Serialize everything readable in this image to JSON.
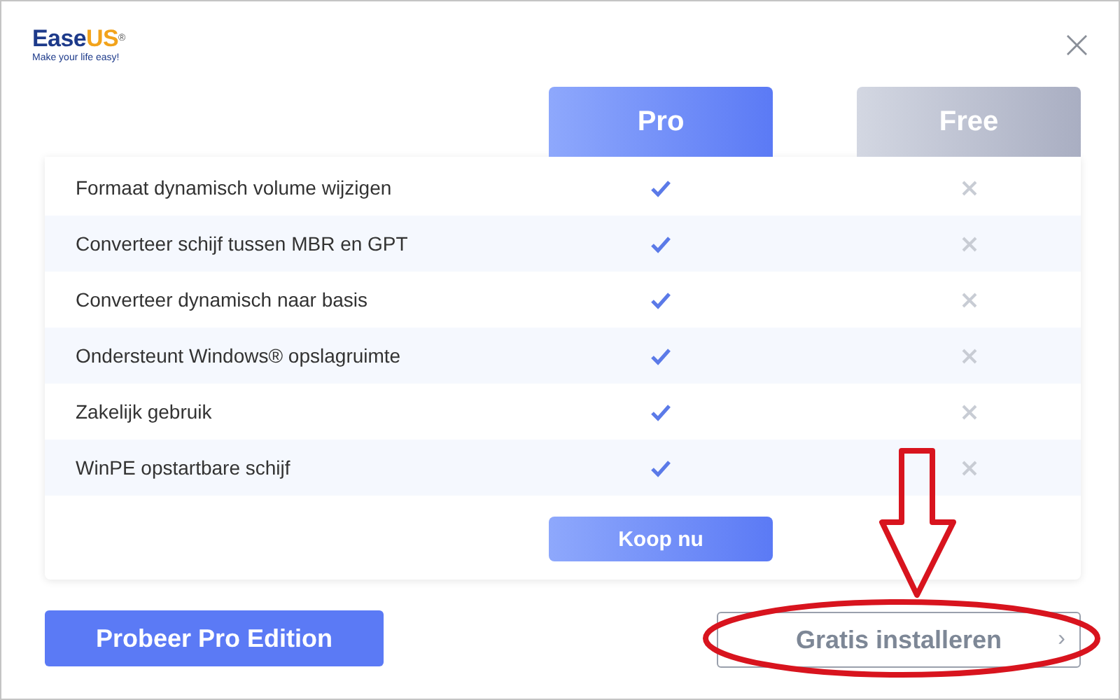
{
  "logo": {
    "brand_dark": "Ease",
    "brand_accent": "US",
    "registered": "®",
    "tagline": "Make your life easy!"
  },
  "close": "×",
  "plans": [
    {
      "name": "Pro",
      "kind": "pro"
    },
    {
      "name": "Free",
      "kind": "free"
    }
  ],
  "features": [
    {
      "label": "Formaat dynamisch volume wijzigen",
      "pro": true,
      "free": false
    },
    {
      "label": "Converteer schijf tussen MBR en GPT",
      "pro": true,
      "free": false
    },
    {
      "label": "Converteer dynamisch naar basis",
      "pro": true,
      "free": false
    },
    {
      "label": "Ondersteunt Windows® opslagruimte",
      "pro": true,
      "free": false
    },
    {
      "label": "Zakelijk gebruik",
      "pro": true,
      "free": false
    },
    {
      "label": "WinPE opstartbare schijf",
      "pro": true,
      "free": false
    }
  ],
  "buy_button": "Koop nu",
  "trial_button": "Probeer Pro Edition",
  "free_button": {
    "label": "Gratis installeren",
    "chevron": "›"
  }
}
